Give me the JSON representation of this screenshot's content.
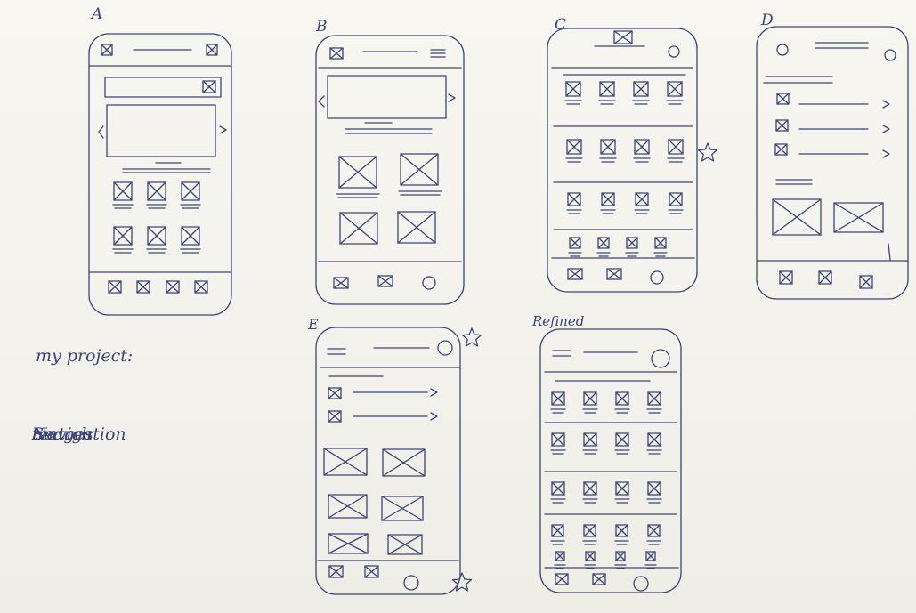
{
  "sketch_labels": {
    "a": "A",
    "b": "B",
    "c": "C",
    "d": "D",
    "e": "E",
    "refined": "Refined"
  },
  "notes": {
    "project": "my project:",
    "items": [
      "Navigation",
      "images",
      "text",
      "Search"
    ]
  },
  "ink_color": "#3d4577"
}
